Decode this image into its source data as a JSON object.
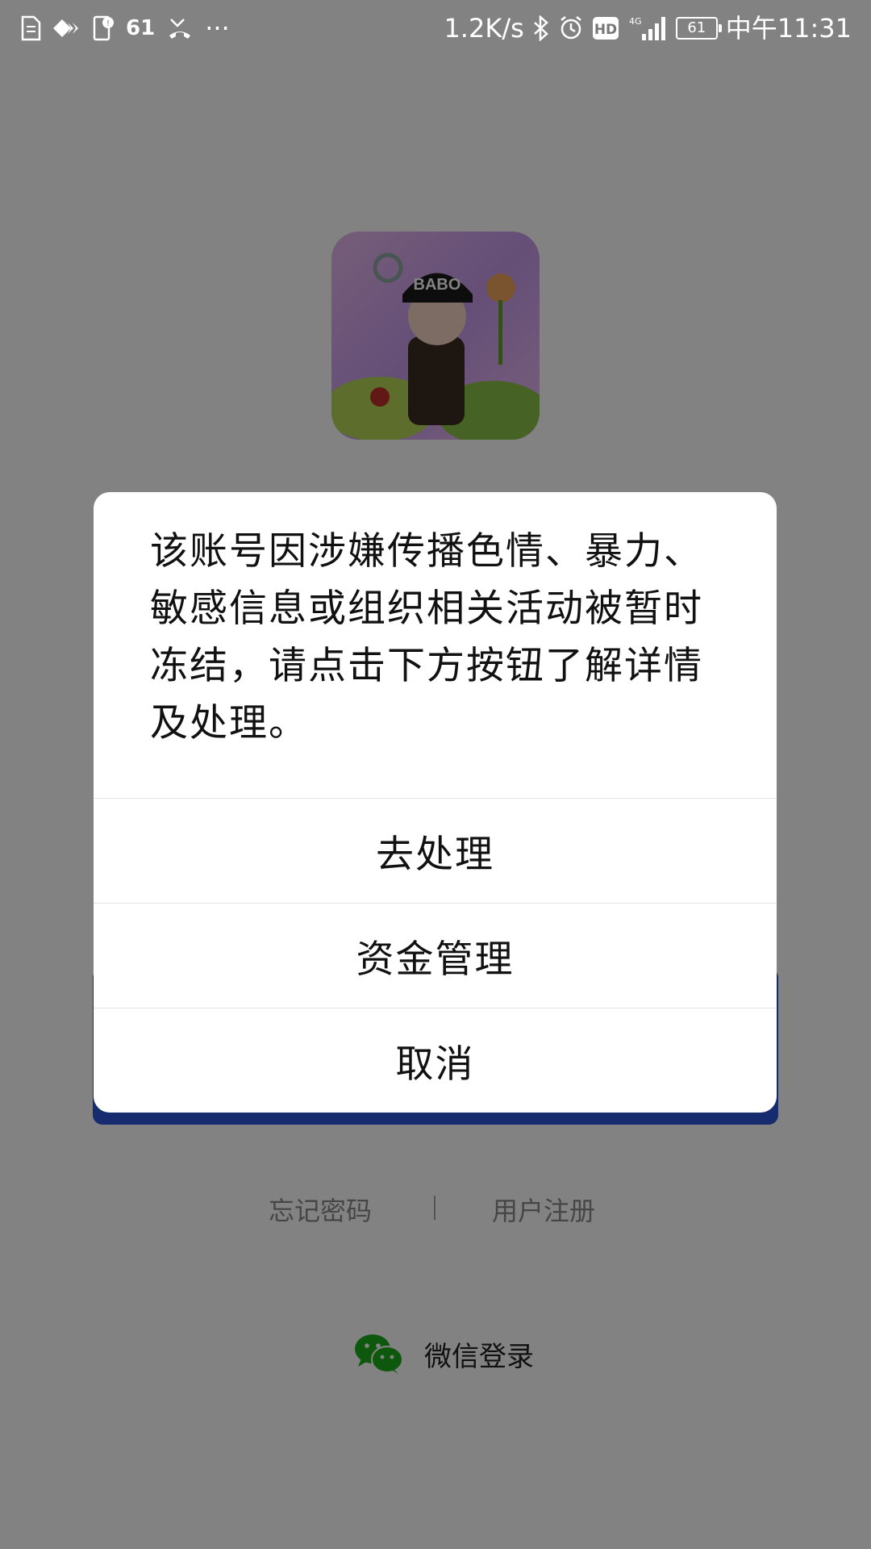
{
  "status_bar": {
    "notification_count": "61",
    "more": "···",
    "network_speed": "1.2K/s",
    "hd_badge": "HD",
    "network_type": "4G",
    "battery_level": "61",
    "time": "中午11:31",
    "icons": [
      "sim-card-icon",
      "signal-diamond-icon",
      "notification-icon",
      "missed-call-icon",
      "bluetooth-icon",
      "alarm-icon",
      "cell-signal-icon",
      "battery-icon"
    ]
  },
  "login": {
    "forgot_password": "忘记密码",
    "register": "用户注册",
    "wechat_login": "微信登录",
    "login_button_color": "#2b56d8",
    "wechat_color": "#1aad19"
  },
  "dialog": {
    "message": "该账号因涉嫌传播色情、暴力、敏感信息或组织相关活动被暂时冻结，请点击下方按钮了解详情及处理。",
    "actions": [
      {
        "label": "去处理"
      },
      {
        "label": "资金管理"
      },
      {
        "label": "取消"
      }
    ]
  }
}
